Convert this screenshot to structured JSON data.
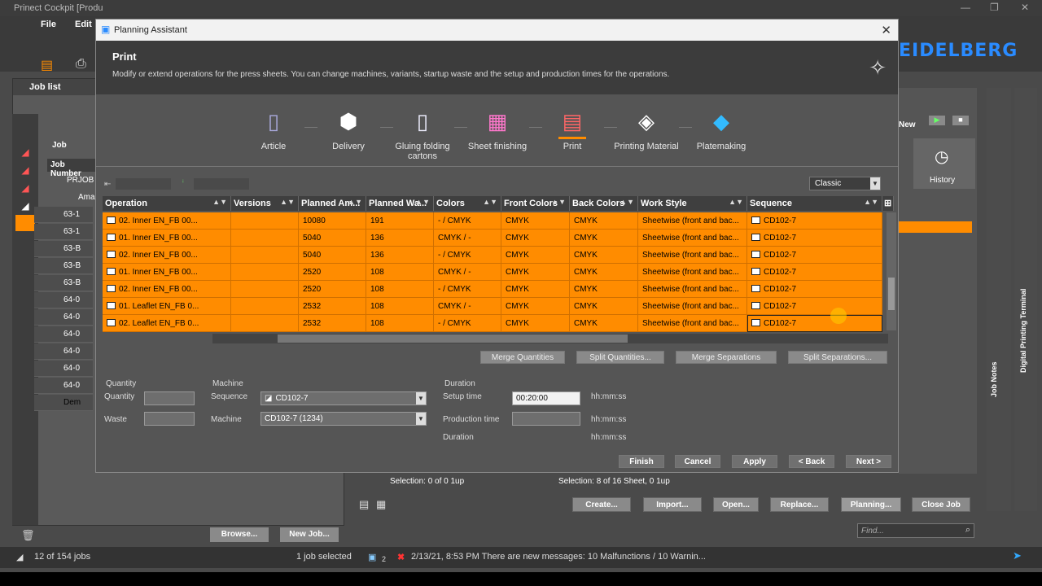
{
  "app": {
    "title": "Prinect Cockpit [Produ",
    "menu": [
      "File",
      "Edit"
    ],
    "brand": "EIDELBERG",
    "job_list_label": "Job list",
    "job_header": "Job Number",
    "job_prefix": "Job",
    "prjob": "PRJOB",
    "ama": "Ama",
    "job_rows": [
      "63-1",
      "63-1",
      "63-B",
      "63-B",
      "63-B",
      "64-0",
      "64-0",
      "64-0",
      "64-0",
      "64-0",
      "64-0",
      "Dem"
    ],
    "browse": "Browse...",
    "new_job": "New Job...",
    "new_label": "New",
    "history": "History",
    "job_notes": "Job Notes",
    "digital_printing_terminal": "Digital Printing Terminal",
    "selection_left": "Selection:  0 of 0 1up",
    "selection_right": "Selection:  8 of 16 Sheet,  0 1up",
    "bottom_buttons": [
      "Create...",
      "Import...",
      "Open...",
      "Replace...",
      "Planning...",
      "Close Job"
    ],
    "find_placeholder": "Find...",
    "status": {
      "jobs": "12 of 154 jobs",
      "selected": "1 job selected",
      "badge": "2",
      "message": "2/13/21, 8:53 PM  There are new messages: 10 Malfunctions / 10 Warnin..."
    }
  },
  "dialog": {
    "title": "Planning Assistant",
    "header": "Print",
    "description": "Modify or extend operations for the press sheets. You can change machines, variants, startup waste and the setup and production times for the operations.",
    "steps": [
      {
        "label": "Article",
        "icon": "article-icon"
      },
      {
        "label": "Delivery",
        "icon": "delivery-icon"
      },
      {
        "label": "Gluing folding cartons",
        "icon": "gluing-icon"
      },
      {
        "label": "Sheet finishing",
        "icon": "sheet-finishing-icon"
      },
      {
        "label": "Print",
        "icon": "print-icon"
      },
      {
        "label": "Printing Material",
        "icon": "printing-material-icon"
      },
      {
        "label": "Platemaking",
        "icon": "platemaking-icon"
      }
    ],
    "view_select": "Classic",
    "columns": [
      "Operation",
      "Versions",
      "Planned Am...",
      "Planned Wa...",
      "Colors",
      "Front Colors",
      "Back Colors",
      "Work Style",
      "Sequence"
    ],
    "rows": [
      [
        "02. Inner EN_FB 00...",
        "",
        "10080",
        "191",
        "- / CMYK",
        "CMYK",
        "CMYK",
        "Sheetwise (front and bac...",
        "CD102-7"
      ],
      [
        "01. Inner EN_FB 00...",
        "",
        "5040",
        "136",
        "CMYK / -",
        "CMYK",
        "CMYK",
        "Sheetwise (front and bac...",
        "CD102-7"
      ],
      [
        "02. Inner EN_FB 00...",
        "",
        "5040",
        "136",
        "- / CMYK",
        "CMYK",
        "CMYK",
        "Sheetwise (front and bac...",
        "CD102-7"
      ],
      [
        "01. Inner EN_FB 00...",
        "",
        "2520",
        "108",
        "CMYK / -",
        "CMYK",
        "CMYK",
        "Sheetwise (front and bac...",
        "CD102-7"
      ],
      [
        "02. Inner EN_FB 00...",
        "",
        "2520",
        "108",
        "- / CMYK",
        "CMYK",
        "CMYK",
        "Sheetwise (front and bac...",
        "CD102-7"
      ],
      [
        "01. Leaflet EN_FB 0...",
        "",
        "2532",
        "108",
        "CMYK / -",
        "CMYK",
        "CMYK",
        "Sheetwise (front and bac...",
        "CD102-7"
      ],
      [
        "02. Leaflet EN_FB 0...",
        "",
        "2532",
        "108",
        "- / CMYK",
        "CMYK",
        "CMYK",
        "Sheetwise (front and bac...",
        "CD102-7"
      ]
    ],
    "actions": [
      "Merge Quantities",
      "Split Quantities...",
      "Merge Separations",
      "Split Separations..."
    ],
    "form": {
      "quantity_group": "Quantity",
      "quantity_label": "Quantity",
      "waste_label": "Waste",
      "machine_group": "Machine",
      "sequence_label": "Sequence",
      "sequence_value": "CD102-7",
      "machine_label": "Machine",
      "machine_value": "CD102-7 (1234)",
      "duration_group": "Duration",
      "setup_label": "Setup time",
      "setup_value": "00:20:00",
      "production_label": "Production time",
      "duration_label": "Duration",
      "unit": "hh:mm:ss"
    },
    "footer_buttons": [
      "Finish",
      "Cancel",
      "Apply",
      "< Back",
      "Next >"
    ]
  },
  "colors": {
    "accent": "#ff8c00",
    "brand": "#2a8bff"
  }
}
